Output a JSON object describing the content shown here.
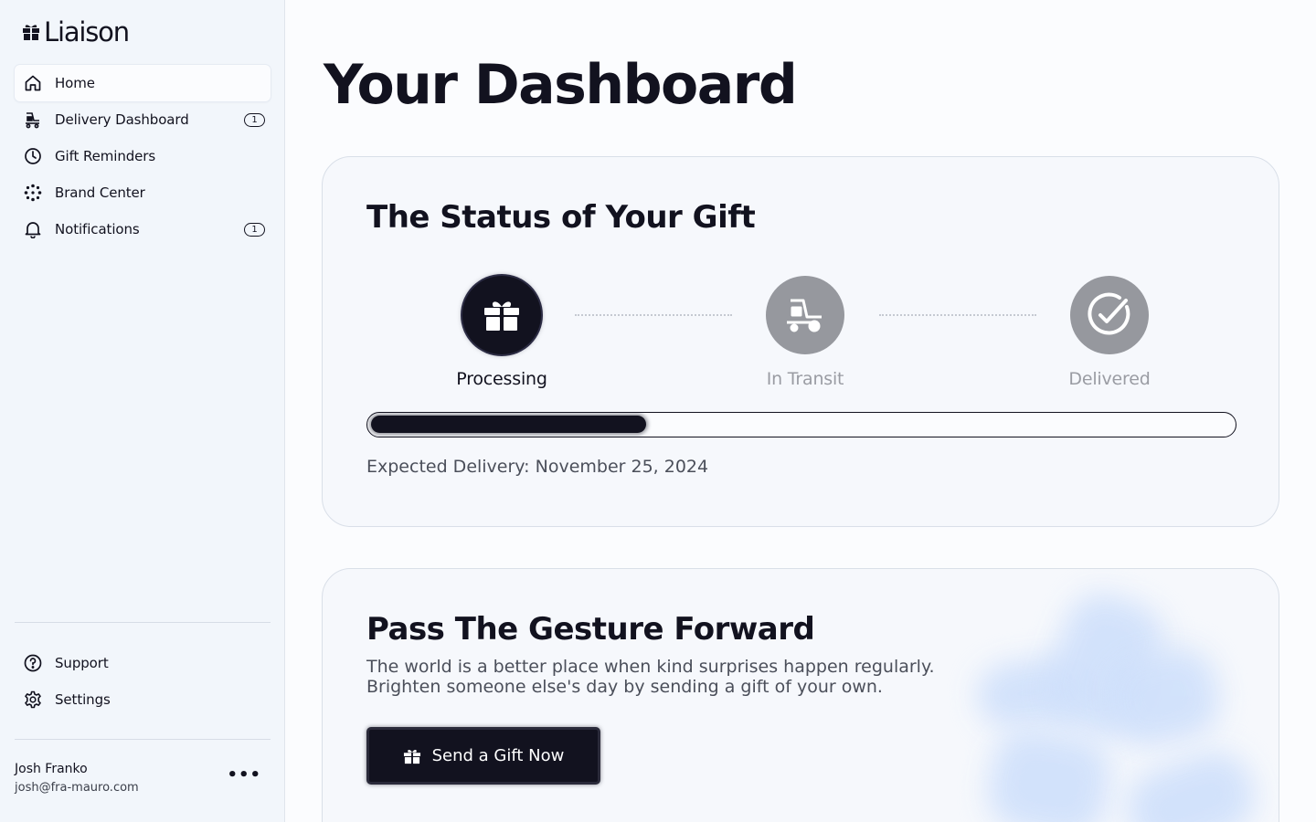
{
  "app": {
    "name": "Liaison"
  },
  "sidebar": {
    "items": [
      {
        "label": "Home",
        "icon": "home-icon",
        "badge": ""
      },
      {
        "label": "Delivery Dashboard",
        "icon": "delivery-cart-icon",
        "badge": "1"
      },
      {
        "label": "Gift Reminders",
        "icon": "clock-icon",
        "badge": ""
      },
      {
        "label": "Brand Center",
        "icon": "dots-grid-icon",
        "badge": ""
      },
      {
        "label": "Notifications",
        "icon": "bell-icon",
        "badge": "1"
      }
    ],
    "bottom_items": [
      {
        "label": "Support",
        "icon": "help-circle-icon"
      },
      {
        "label": "Settings",
        "icon": "gear-icon"
      }
    ],
    "user": {
      "name": "Josh Franko",
      "email": "josh@fra-mauro.com",
      "menu": "•••"
    }
  },
  "main": {
    "title": "Your Dashboard",
    "status_card": {
      "title": "The Status of Your Gift",
      "steps": [
        {
          "label": "Processing",
          "icon": "gift-icon",
          "state": "active"
        },
        {
          "label": "In Transit",
          "icon": "delivery-cart-icon",
          "state": "pending"
        },
        {
          "label": "Delivered",
          "icon": "check-circle-icon",
          "state": "pending"
        }
      ],
      "progress": 0.32,
      "expected_delivery": "Expected Delivery: November 25, 2024"
    },
    "forward_card": {
      "title": "Pass The Gesture Forward",
      "text_line1": "The world is a better place when kind surprises happen regularly.",
      "text_line2": "Brighten someone else's day by sending a gift of your own.",
      "button_label": "Send a Gift Now"
    }
  },
  "colors": {
    "ink": "#12121f",
    "sidebar_bg": "#f2f6fb",
    "card_bg": "#f6f8fc",
    "pending": "#96989e"
  }
}
